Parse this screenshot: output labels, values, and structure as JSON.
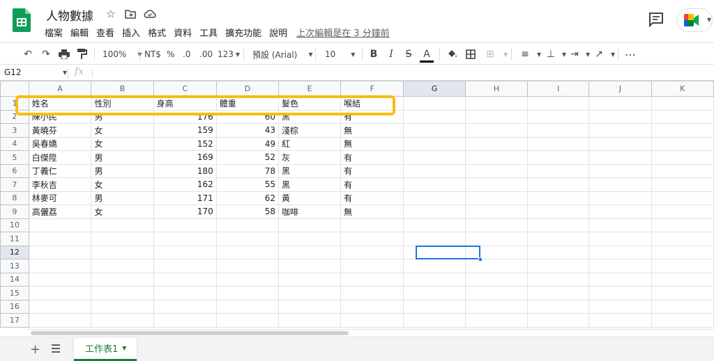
{
  "app": {
    "doc_title": "人物數據",
    "brand_color": "#0f9d58",
    "accent_color": "#1a73e8",
    "highlight_color": "#f9bc0e"
  },
  "menu": {
    "items": [
      "檔案",
      "編輯",
      "查看",
      "插入",
      "格式",
      "資料",
      "工具",
      "擴充功能",
      "說明"
    ],
    "last_edit": "上次編輯是在 3 分鐘前"
  },
  "toolbar": {
    "zoom": "100%",
    "currency": "NT$",
    "percent": "%",
    "decrease_decimal": ".0",
    "increase_decimal": ".00",
    "more_formats": "123",
    "font": "預設 (Arial)",
    "font_size": "10",
    "bold": "B",
    "italic": "I",
    "strike": "S",
    "text_color": "A",
    "more": "⋯"
  },
  "formula_bar": {
    "cell_ref": "G12",
    "fx": "fx"
  },
  "grid": {
    "columns": [
      "A",
      "B",
      "C",
      "D",
      "E",
      "F",
      "G",
      "H",
      "I",
      "J",
      "K"
    ],
    "selected_column": "G",
    "selected_row": "12",
    "row_numbers": [
      "1",
      "2",
      "3",
      "4",
      "5",
      "6",
      "7",
      "8",
      "9",
      "10",
      "11",
      "12",
      "13",
      "14",
      "15",
      "16",
      "17"
    ],
    "headers": [
      "姓名",
      "性別",
      "身高",
      "體重",
      "髮色",
      "喉結"
    ],
    "rows": [
      [
        "陳小民",
        "男",
        "176",
        "60",
        "黑",
        "有"
      ],
      [
        "黃曉芬",
        "女",
        "159",
        "43",
        "淺棕",
        "無"
      ],
      [
        "吳春嬌",
        "女",
        "152",
        "49",
        "紅",
        "無"
      ],
      [
        "白傑陞",
        "男",
        "169",
        "52",
        "灰",
        "有"
      ],
      [
        "丁義仁",
        "男",
        "180",
        "78",
        "黑",
        "有"
      ],
      [
        "李秋吉",
        "女",
        "162",
        "55",
        "黑",
        "有"
      ],
      [
        "林麥可",
        "男",
        "171",
        "62",
        "黃",
        "有"
      ],
      [
        "高儷荔",
        "女",
        "170",
        "58",
        "咖啡",
        "無"
      ]
    ]
  },
  "sheets": {
    "add": "+",
    "tabs": [
      {
        "label": "工作表1"
      }
    ]
  }
}
